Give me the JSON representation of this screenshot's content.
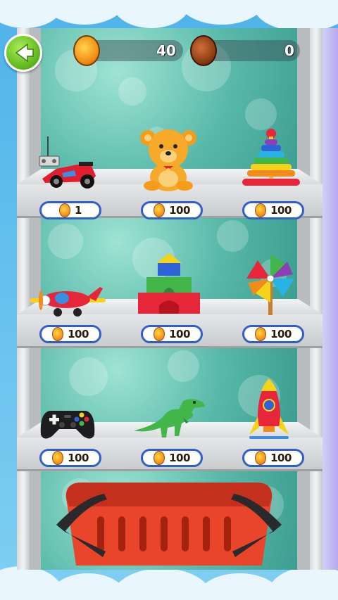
{
  "hud": {
    "gold_coins": "40",
    "bronze_coins": "0"
  },
  "colors": {
    "gold": "#f5a623",
    "bronze": "#8a3b12",
    "price_border": "#2f5fc8",
    "back_button": "#5cb51a",
    "shelf_backdrop": "#58b9a9",
    "basket": "#e8452a"
  },
  "toys": [
    {
      "id": "rc-car",
      "icon": "rc-car-icon",
      "price": "1"
    },
    {
      "id": "teddy-bear",
      "icon": "teddy-bear-icon",
      "price": "100"
    },
    {
      "id": "ring-stacker",
      "icon": "ring-stacker-icon",
      "price": "100"
    },
    {
      "id": "toy-airplane",
      "icon": "airplane-icon",
      "price": "100"
    },
    {
      "id": "building-blocks",
      "icon": "blocks-icon",
      "price": "100"
    },
    {
      "id": "pinwheel",
      "icon": "pinwheel-icon",
      "price": "100"
    },
    {
      "id": "game-controller",
      "icon": "gamepad-icon",
      "price": "100"
    },
    {
      "id": "dinosaur",
      "icon": "dinosaur-icon",
      "price": "100"
    },
    {
      "id": "toy-rocket",
      "icon": "rocket-icon",
      "price": "100"
    }
  ],
  "icons": {
    "back": "back-arrow-icon",
    "basket": "shopping-basket-icon"
  }
}
